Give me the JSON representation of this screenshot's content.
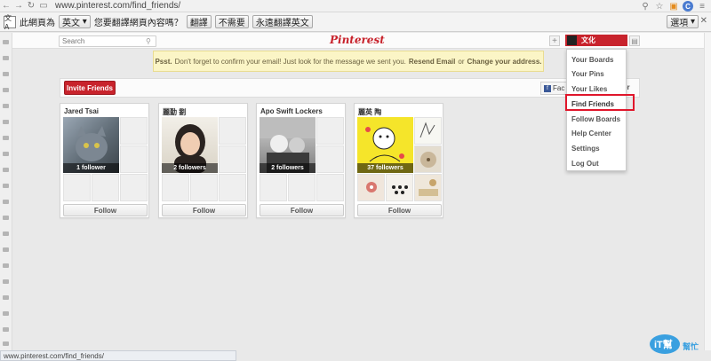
{
  "browser": {
    "url": "www.pinterest.com/find_friends/"
  },
  "translate_bar": {
    "icon_label": "文A",
    "page_lang_label": "此網頁為",
    "page_lang_value": "英文",
    "question": "您要翻譯網頁內容嗎？",
    "translate_button": "翻譯",
    "no_button": "不需要",
    "always_button": "永遠翻譯英文",
    "options_button": "選項"
  },
  "header": {
    "search_placeholder": "Search",
    "logo": "Pinterest",
    "add_label": "+",
    "user_label": "文化"
  },
  "notice": {
    "prefix": "Psst.",
    "message": "Don't forget to confirm your email! Just look for the message we sent you.",
    "resend_link": "Resend Email",
    "or_text": "or",
    "change_link": "Change your address."
  },
  "invite": {
    "button_label": "Invite Friends",
    "facebook_label": "Fac",
    "tail_label": "er"
  },
  "friends": [
    {
      "name": "Jared Tsai",
      "followers": "1 follower",
      "follow_label": "Follow"
    },
    {
      "name": "麗勤 劉",
      "followers": "2 followers",
      "follow_label": "Follow"
    },
    {
      "name": "Apo Swift Lockers",
      "followers": "2 followers",
      "follow_label": "Follow"
    },
    {
      "name": "麗英 陶",
      "followers": "37 followers",
      "follow_label": "Follow"
    }
  ],
  "dropdown": {
    "items": [
      "Your Boards",
      "Your Pins",
      "Your Likes",
      "Find Friends",
      "Follow Boards",
      "Help Center",
      "Settings",
      "Log Out"
    ],
    "highlighted": "Find Friends"
  },
  "status_bar": {
    "text": "www.pinterest.com/find_friends/"
  },
  "watermark": {
    "text": "iT幫 幫忙"
  },
  "colors": {
    "brand_red": "#c8232c",
    "highlight": "#e0162b",
    "notice_bg": "#fbf5c6"
  }
}
